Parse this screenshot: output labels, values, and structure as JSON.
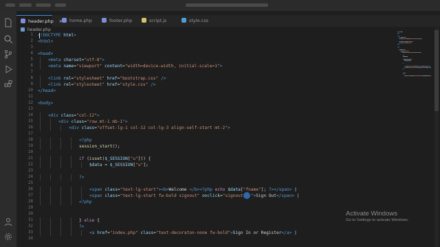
{
  "editor": {
    "tabs": [
      {
        "label": "header.php",
        "close": "✕",
        "color": "#7f8fd6"
      },
      {
        "label": "home.php",
        "color": "#7f8fd6"
      },
      {
        "label": "footer.php",
        "color": "#7f8fd6"
      },
      {
        "label": "script.js",
        "color": "#d6c36b"
      },
      {
        "label": "style.css",
        "color": "#4f9fd6"
      }
    ],
    "breadcrumb": "header.php",
    "activity_icons": [
      "files-icon",
      "search-icon",
      "source-control-icon",
      "run-debug-icon",
      "extensions-icon",
      "account-icon",
      "settings-icon"
    ]
  },
  "code": {
    "lines": [
      {
        "n": "1",
        "indent": 0,
        "parts": [
          {
            "t": "<!DOCTYPE ",
            "c": "#569cd6"
          },
          {
            "t": "html",
            "c": "#9cdcfe"
          },
          {
            "t": ">",
            "c": "#569cd6"
          }
        ]
      },
      {
        "n": "2",
        "indent": 0,
        "parts": [
          {
            "t": "<html>",
            "c": "#569cd6"
          }
        ]
      },
      {
        "n": "3",
        "indent": 0,
        "parts": []
      },
      {
        "n": "4",
        "indent": 0,
        "parts": [
          {
            "t": "<head>",
            "c": "#569cd6"
          }
        ]
      },
      {
        "n": "5",
        "indent": 1,
        "parts": [
          {
            "t": "<meta ",
            "c": "#569cd6"
          },
          {
            "t": "charset",
            "c": "#9cdcfe"
          },
          {
            "t": "=",
            "c": "#d4d4d4"
          },
          {
            "t": "\"utf-8\"",
            "c": "#ce9178"
          },
          {
            "t": ">",
            "c": "#569cd6"
          }
        ]
      },
      {
        "n": "6",
        "indent": 1,
        "parts": [
          {
            "t": "<meta ",
            "c": "#569cd6"
          },
          {
            "t": "name",
            "c": "#9cdcfe"
          },
          {
            "t": "=",
            "c": "#d4d4d4"
          },
          {
            "t": "\"viewport\"",
            "c": "#ce9178"
          },
          {
            "t": " content",
            "c": "#9cdcfe"
          },
          {
            "t": "=",
            "c": "#d4d4d4"
          },
          {
            "t": "\"width=device-width, initial-scale=1\"",
            "c": "#ce9178"
          },
          {
            "t": ">",
            "c": "#569cd6"
          }
        ]
      },
      {
        "n": "7",
        "indent": 0,
        "parts": []
      },
      {
        "n": "8",
        "indent": 1,
        "parts": [
          {
            "t": "<link ",
            "c": "#569cd6"
          },
          {
            "t": "rel",
            "c": "#9cdcfe"
          },
          {
            "t": "=",
            "c": "#d4d4d4"
          },
          {
            "t": "\"stylesheet\"",
            "c": "#ce9178"
          },
          {
            "t": " href",
            "c": "#9cdcfe"
          },
          {
            "t": "=",
            "c": "#d4d4d4"
          },
          {
            "t": "\"bootstrap.css\"",
            "c": "#ce9178"
          },
          {
            "t": " />",
            "c": "#569cd6"
          }
        ]
      },
      {
        "n": "9",
        "indent": 1,
        "parts": [
          {
            "t": "<link ",
            "c": "#569cd6"
          },
          {
            "t": "rel",
            "c": "#9cdcfe"
          },
          {
            "t": "=",
            "c": "#d4d4d4"
          },
          {
            "t": "\"stylesheet\"",
            "c": "#ce9178"
          },
          {
            "t": " href",
            "c": "#9cdcfe"
          },
          {
            "t": "=",
            "c": "#d4d4d4"
          },
          {
            "t": "\"style.css\"",
            "c": "#ce9178"
          },
          {
            "t": " />",
            "c": "#569cd6"
          }
        ]
      },
      {
        "n": "10",
        "indent": 0,
        "parts": [
          {
            "t": "</head>",
            "c": "#569cd6"
          }
        ]
      },
      {
        "n": "11",
        "indent": 0,
        "parts": []
      },
      {
        "n": "12",
        "indent": 0,
        "parts": [
          {
            "t": "<body>",
            "c": "#569cd6"
          }
        ]
      },
      {
        "n": "13",
        "indent": 0,
        "parts": []
      },
      {
        "n": "14",
        "indent": 1,
        "parts": [
          {
            "t": "<div ",
            "c": "#569cd6"
          },
          {
            "t": "class",
            "c": "#9cdcfe"
          },
          {
            "t": "=",
            "c": "#d4d4d4"
          },
          {
            "t": "\"col-12\"",
            "c": "#ce9178"
          },
          {
            "t": ">",
            "c": "#569cd6"
          }
        ]
      },
      {
        "n": "15",
        "indent": 2,
        "parts": [
          {
            "t": "<div ",
            "c": "#569cd6"
          },
          {
            "t": "class",
            "c": "#9cdcfe"
          },
          {
            "t": "=",
            "c": "#d4d4d4"
          },
          {
            "t": "\"row mt-1 mb-1\"",
            "c": "#ce9178"
          },
          {
            "t": ">",
            "c": "#569cd6"
          }
        ]
      },
      {
        "n": "16",
        "indent": 3,
        "parts": [
          {
            "t": "<div ",
            "c": "#569cd6"
          },
          {
            "t": "class",
            "c": "#9cdcfe"
          },
          {
            "t": "=",
            "c": "#d4d4d4"
          },
          {
            "t": "\"offset-lg-1 col-12 col-lg-3 align-self-start mt-2\"",
            "c": "#ce9178"
          },
          {
            "t": ">",
            "c": "#569cd6"
          }
        ]
      },
      {
        "n": "17",
        "indent": 0,
        "parts": []
      },
      {
        "n": "18",
        "indent": 4,
        "parts": [
          {
            "t": "<?php",
            "c": "#569cd6"
          }
        ]
      },
      {
        "n": "19",
        "indent": 4,
        "parts": [
          {
            "t": "session_start",
            "c": "#dcdcaa"
          },
          {
            "t": "();",
            "c": "#d4d4d4"
          }
        ]
      },
      {
        "n": "20",
        "indent": 0,
        "parts": []
      },
      {
        "n": "21",
        "indent": 4,
        "parts": [
          {
            "t": "if ",
            "c": "#c586c0"
          },
          {
            "t": "(",
            "c": "#d4d4d4"
          },
          {
            "t": "isset",
            "c": "#dcdcaa"
          },
          {
            "t": "(",
            "c": "#d4d4d4"
          },
          {
            "t": "$_SESSION",
            "c": "#9cdcfe"
          },
          {
            "t": "[",
            "c": "#d4d4d4"
          },
          {
            "t": "\"u\"",
            "c": "#ce9178"
          },
          {
            "t": "])) {",
            "c": "#d4d4d4"
          }
        ]
      },
      {
        "n": "22",
        "indent": 5,
        "parts": [
          {
            "t": "$data",
            "c": "#9cdcfe"
          },
          {
            "t": " = ",
            "c": "#d4d4d4"
          },
          {
            "t": "$_SESSION",
            "c": "#9cdcfe"
          },
          {
            "t": "[",
            "c": "#d4d4d4"
          },
          {
            "t": "\"u\"",
            "c": "#ce9178"
          },
          {
            "t": "];",
            "c": "#d4d4d4"
          }
        ]
      },
      {
        "n": "23",
        "indent": 0,
        "parts": []
      },
      {
        "n": "24",
        "indent": 4,
        "parts": [
          {
            "t": "?>",
            "c": "#569cd6"
          }
        ]
      },
      {
        "n": "25",
        "indent": 0,
        "parts": []
      },
      {
        "n": "26",
        "indent": 5,
        "parts": [
          {
            "t": "<span ",
            "c": "#569cd6"
          },
          {
            "t": "class",
            "c": "#9cdcfe"
          },
          {
            "t": "=",
            "c": "#d4d4d4"
          },
          {
            "t": "\"text-lg-start\"",
            "c": "#ce9178"
          },
          {
            "t": ">",
            "c": "#569cd6"
          },
          {
            "t": "<b>",
            "c": "#569cd6"
          },
          {
            "t": "Welcome ",
            "c": "#d4d4d4"
          },
          {
            "t": "</b>",
            "c": "#569cd6"
          },
          {
            "t": "<?php ",
            "c": "#569cd6"
          },
          {
            "t": "echo ",
            "c": "#c586c0"
          },
          {
            "t": "$data",
            "c": "#9cdcfe"
          },
          {
            "t": "[",
            "c": "#d4d4d4"
          },
          {
            "t": "\"fname\"",
            "c": "#ce9178"
          },
          {
            "t": "]; ",
            "c": "#d4d4d4"
          },
          {
            "t": "?>",
            "c": "#569cd6"
          },
          {
            "t": "</span>",
            "c": "#569cd6"
          },
          {
            "t": " |",
            "c": "#d4d4d4"
          }
        ]
      },
      {
        "n": "27",
        "indent": 5,
        "parts": [
          {
            "t": "<span ",
            "c": "#569cd6"
          },
          {
            "t": "class",
            "c": "#9cdcfe"
          },
          {
            "t": "=",
            "c": "#d4d4d4"
          },
          {
            "t": "\"text-lg-start fw-bold signout\"",
            "c": "#ce9178"
          },
          {
            "t": " onclick",
            "c": "#9cdcfe"
          },
          {
            "t": "=",
            "c": "#d4d4d4"
          },
          {
            "t": "\"signout();\"",
            "c": "#ce9178"
          },
          {
            "t": ">",
            "c": "#569cd6"
          },
          {
            "t": "Sign Out",
            "c": "#d4d4d4"
          },
          {
            "t": "</span>",
            "c": "#569cd6"
          },
          {
            "t": " |",
            "c": "#d4d4d4"
          }
        ]
      },
      {
        "n": "28",
        "indent": 4,
        "parts": [
          {
            "t": "<?php",
            "c": "#569cd6"
          }
        ]
      },
      {
        "n": "29",
        "indent": 0,
        "parts": []
      },
      {
        "n": "30",
        "indent": 0,
        "parts": []
      },
      {
        "n": "31",
        "indent": 4,
        "parts": [
          {
            "t": "} ",
            "c": "#d4d4d4"
          },
          {
            "t": "else",
            "c": "#c586c0"
          },
          {
            "t": " {",
            "c": "#d4d4d4"
          }
        ]
      },
      {
        "n": "32",
        "indent": 4,
        "parts": [
          {
            "t": "?>",
            "c": "#569cd6"
          }
        ]
      },
      {
        "n": "33",
        "indent": 5,
        "parts": [
          {
            "t": "<a ",
            "c": "#569cd6"
          },
          {
            "t": "href",
            "c": "#9cdcfe"
          },
          {
            "t": "=",
            "c": "#d4d4d4"
          },
          {
            "t": "\"index.php\"",
            "c": "#ce9178"
          },
          {
            "t": " class",
            "c": "#9cdcfe"
          },
          {
            "t": "=",
            "c": "#d4d4d4"
          },
          {
            "t": "\"text-decoraton-none fw-bold\"",
            "c": "#ce9178"
          },
          {
            "t": ">",
            "c": "#569cd6"
          },
          {
            "t": "Sign In or Register",
            "c": "#d4d4d4"
          },
          {
            "t": "</a>",
            "c": "#569cd6"
          },
          {
            "t": " |",
            "c": "#d4d4d4"
          }
        ]
      },
      {
        "n": "34",
        "indent": 0,
        "parts": []
      }
    ]
  },
  "watermark": {
    "title": "Activate Windows",
    "subtitle": "Go to Settings to activate Windows."
  }
}
